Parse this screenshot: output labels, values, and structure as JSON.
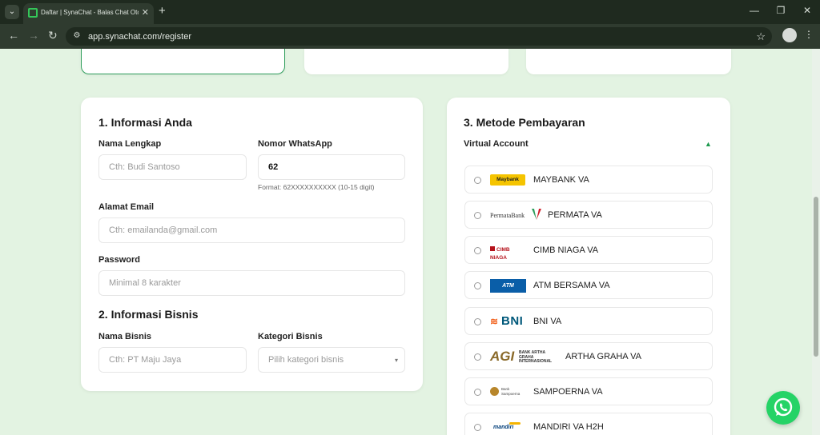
{
  "browser": {
    "tab_title": "Daftar | SynaChat - Balas Chat Oto...",
    "url": "app.synachat.com/register"
  },
  "colors": {
    "brand_green": "#2e9d5b",
    "whatsapp_green": "#25d366",
    "page_bg": "#e3f3e2"
  },
  "form": {
    "section1_title": "1. Informasi Anda",
    "full_name_label": "Nama Lengkap",
    "full_name_placeholder": "Cth: Budi Santoso",
    "whatsapp_label": "Nomor WhatsApp",
    "whatsapp_value": "62",
    "whatsapp_hint": "Format: 62XXXXXXXXXX (10-15 digit)",
    "email_label": "Alamat Email",
    "email_placeholder": "Cth: emailanda@gmail.com",
    "password_label": "Password",
    "password_placeholder": "Minimal 8 karakter",
    "section2_title": "2. Informasi Bisnis",
    "business_name_label": "Nama Bisnis",
    "business_name_placeholder": "Cth: PT Maju Jaya",
    "business_category_label": "Kategori Bisnis",
    "business_category_placeholder": "Pilih kategori bisnis"
  },
  "payment": {
    "section3_title": "3. Metode Pembayaran",
    "group_label": "Virtual Account",
    "methods": [
      {
        "label": "MAYBANK VA",
        "logo_text": "Maybank"
      },
      {
        "label": "PERMATA VA",
        "logo_text": "PermataBank"
      },
      {
        "label": "CIMB NIAGA VA",
        "logo_text": "CIMB NIAGA"
      },
      {
        "label": "ATM BERSAMA VA",
        "logo_text": "ATM"
      },
      {
        "label": "BNI VA",
        "logo_text": "BNI"
      },
      {
        "label": "ARTHA GRAHA VA",
        "logo_text": "AGI",
        "logo_subtext": "BANK ARTHA GRAHA INTERNASIONAL"
      },
      {
        "label": "SAMPOERNA VA",
        "logo_text": "Bank Sampoerna"
      },
      {
        "label": "MANDIRI VA H2H",
        "logo_text": "mandiri"
      }
    ]
  }
}
